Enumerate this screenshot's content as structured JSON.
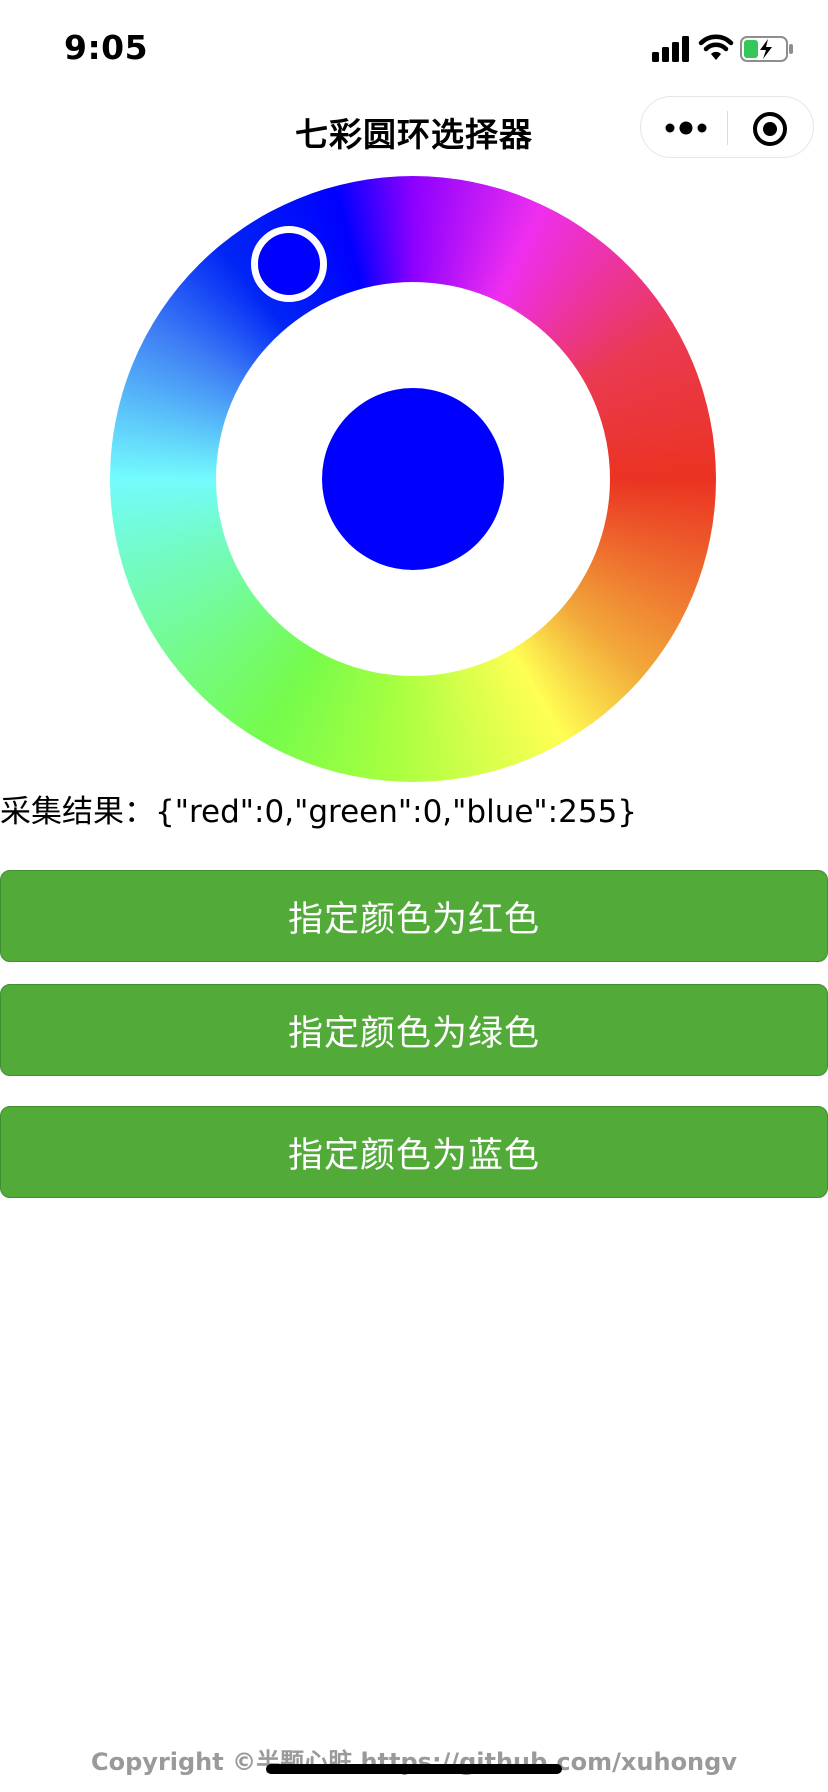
{
  "status_bar": {
    "time": "9:05",
    "icons": [
      "signal-icon",
      "wifi-icon",
      "battery-charging-icon"
    ]
  },
  "nav": {
    "title": "七彩圆环选择器",
    "capsule_icons": [
      "more-icon",
      "target-icon"
    ]
  },
  "color_picker": {
    "selected_color": "#0000ff",
    "handle_border_color": "#ffffff"
  },
  "result": {
    "label": "采集结果：",
    "value": "{\"red\":0,\"green\":0,\"blue\":255}"
  },
  "buttons": [
    {
      "label": "指定颜色为红色"
    },
    {
      "label": "指定颜色为绿色"
    },
    {
      "label": "指定颜色为蓝色"
    }
  ],
  "colors": {
    "button_bg": "#52aa39",
    "button_text": "#ffffff"
  },
  "footer": {
    "copyright": "Copyright ©半颗心脏 https://github.com/xuhongv"
  }
}
